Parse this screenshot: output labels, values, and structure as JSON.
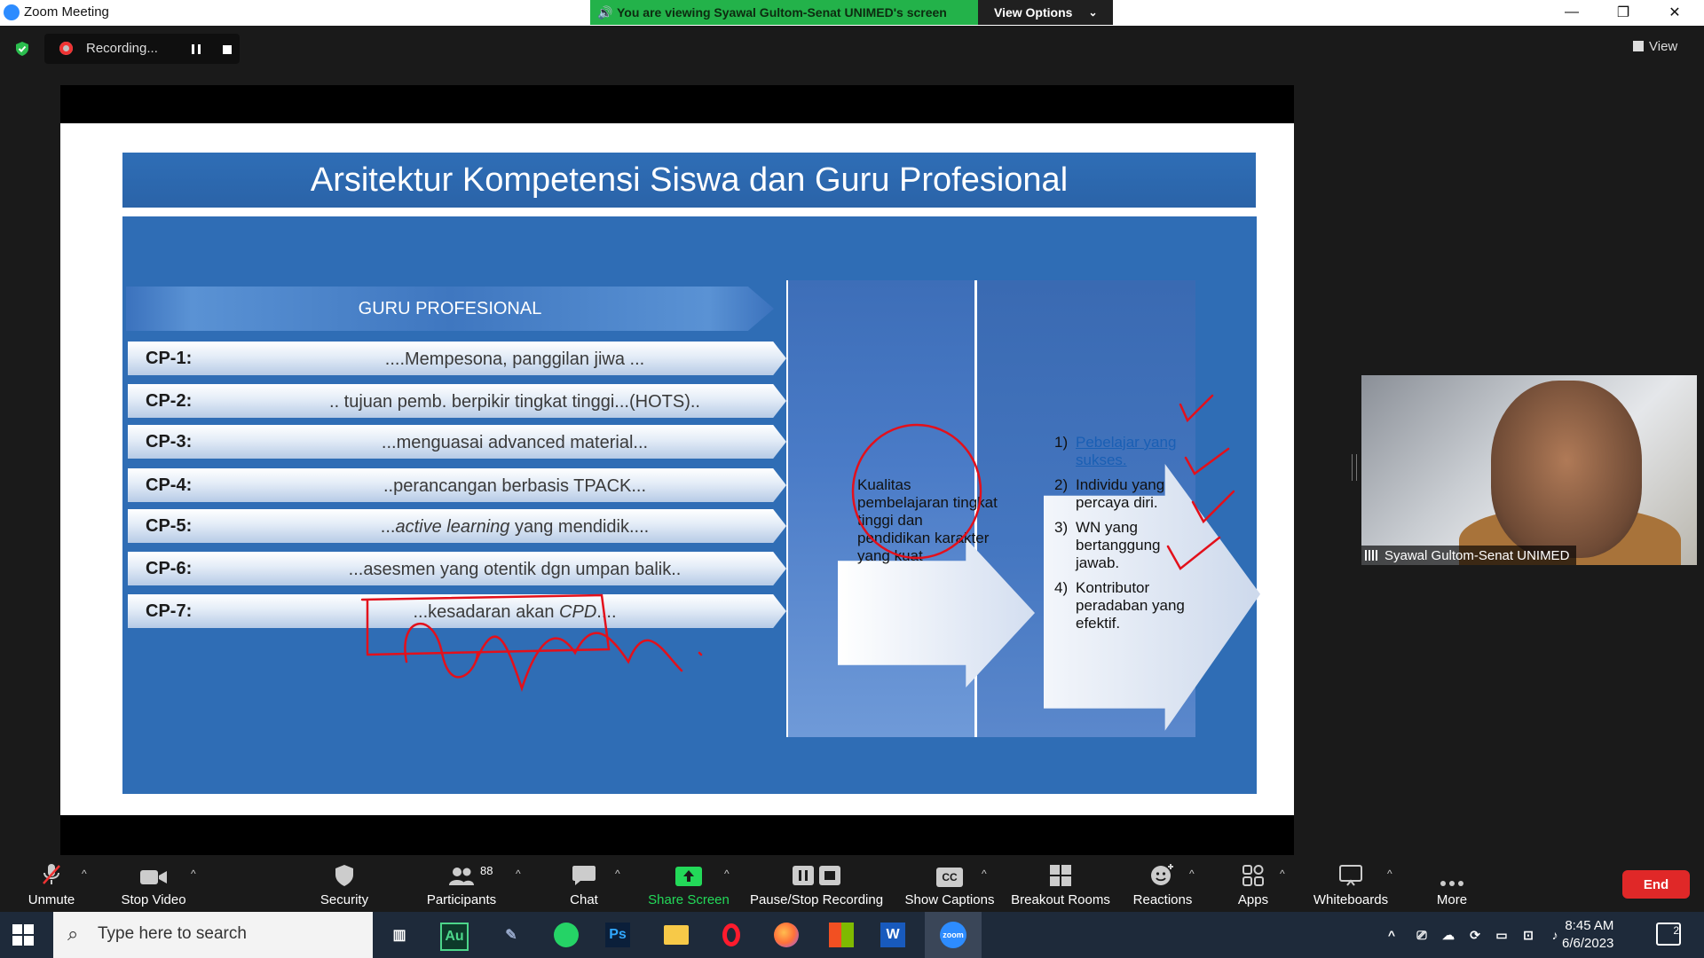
{
  "window": {
    "app_title": "Zoom Meeting",
    "banner_text": "You are viewing Syawal Gultom-Senat UNIMED's screen",
    "view_options_label": "View Options",
    "minimize_symbol": "—",
    "restore_symbol": "❐",
    "close_symbol": "✕"
  },
  "recording": {
    "label": "Recording..."
  },
  "view_button": {
    "label": "View"
  },
  "slide": {
    "title": "Arsitektur Kompetensi Siswa dan Guru Profesional",
    "guru_header": "GURU PROFESIONAL",
    "rows": [
      {
        "label": "CP-1:",
        "text": "....Mempesona, panggilan jiwa ..."
      },
      {
        "label": "CP-2:",
        "text": ".. tujuan pemb. berpikir tingkat tinggi...(HOTS).."
      },
      {
        "label": "CP-3:",
        "text": "...menguasai advanced material..."
      },
      {
        "label": "CP-4:",
        "text": "..perancangan berbasis TPACK..."
      },
      {
        "label": "CP-5:",
        "text_pre": "...",
        "text_italic": "active learning",
        "text_post": " yang mendidik...."
      },
      {
        "label": "CP-6:",
        "text": "...asesmen yang otentik dgn umpan balik.."
      },
      {
        "label": "CP-7:",
        "text_pre": "...kesadaran akan ",
        "text_italic": "CPD",
        "text_post": "...."
      }
    ],
    "middle_text": "Kualitas pembelajaran tingkat tinggi dan pendidikan karakter yang kuat",
    "outcomes": [
      {
        "num": "1)",
        "text": "Pebelajar yang sukses."
      },
      {
        "num": "2)",
        "text": "Individu yang percaya diri."
      },
      {
        "num": "3)",
        "text": "WN yang bertanggung jawab."
      },
      {
        "num": "4)",
        "text": "Kontributor peradaban yang efektif."
      }
    ]
  },
  "participant": {
    "name": "Syawal Gultom-Senat UNIMED"
  },
  "toolbar": {
    "unmute": "Unmute",
    "stop_video": "Stop Video",
    "security": "Security",
    "participants": "Participants",
    "participants_count": "88",
    "chat": "Chat",
    "share_screen": "Share Screen",
    "pause_stop_recording": "Pause/Stop Recording",
    "show_captions": "Show Captions",
    "captions_icon_text": "CC",
    "breakout_rooms": "Breakout Rooms",
    "reactions": "Reactions",
    "apps": "Apps",
    "whiteboards": "Whiteboards",
    "more": "More",
    "end": "End"
  },
  "taskbar": {
    "search_placeholder": "Type here to search",
    "audition_label": "Au",
    "photoshop_label": "Ps",
    "word_label": "W",
    "zoom_label": "zoom",
    "time": "8:45 AM",
    "date": "6/6/2023",
    "notifications": "2"
  },
  "colors": {
    "banner_green": "#23b24a",
    "slide_blue": "#2f6db5",
    "end_red": "#e02828",
    "share_green": "#23d959",
    "ink_red": "#e3101b"
  }
}
